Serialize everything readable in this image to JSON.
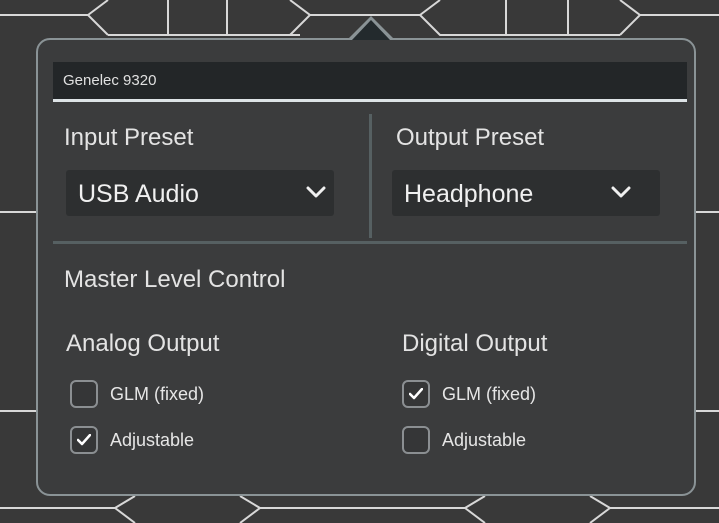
{
  "device": {
    "name": "Genelec 9320"
  },
  "input_preset": {
    "label": "Input Preset",
    "selected": "USB Audio",
    "icon": "chevron-down-icon"
  },
  "output_preset": {
    "label": "Output Preset",
    "selected": "Headphone",
    "icon": "chevron-down-icon"
  },
  "master": {
    "label": "Master Level Control",
    "analog": {
      "label": "Analog Output",
      "options": [
        {
          "label": "GLM (fixed)",
          "checked": false
        },
        {
          "label": "Adjustable",
          "checked": true
        }
      ]
    },
    "digital": {
      "label": "Digital Output",
      "options": [
        {
          "label": "GLM (fixed)",
          "checked": true
        },
        {
          "label": "Adjustable",
          "checked": false
        }
      ]
    }
  },
  "colors": {
    "panel_bg": "#3b3c3d",
    "border": "#8a9396",
    "header_bg": "#232628",
    "accent_line": "#dde3e6",
    "select_bg": "#2d2f30",
    "divider": "#566062"
  }
}
